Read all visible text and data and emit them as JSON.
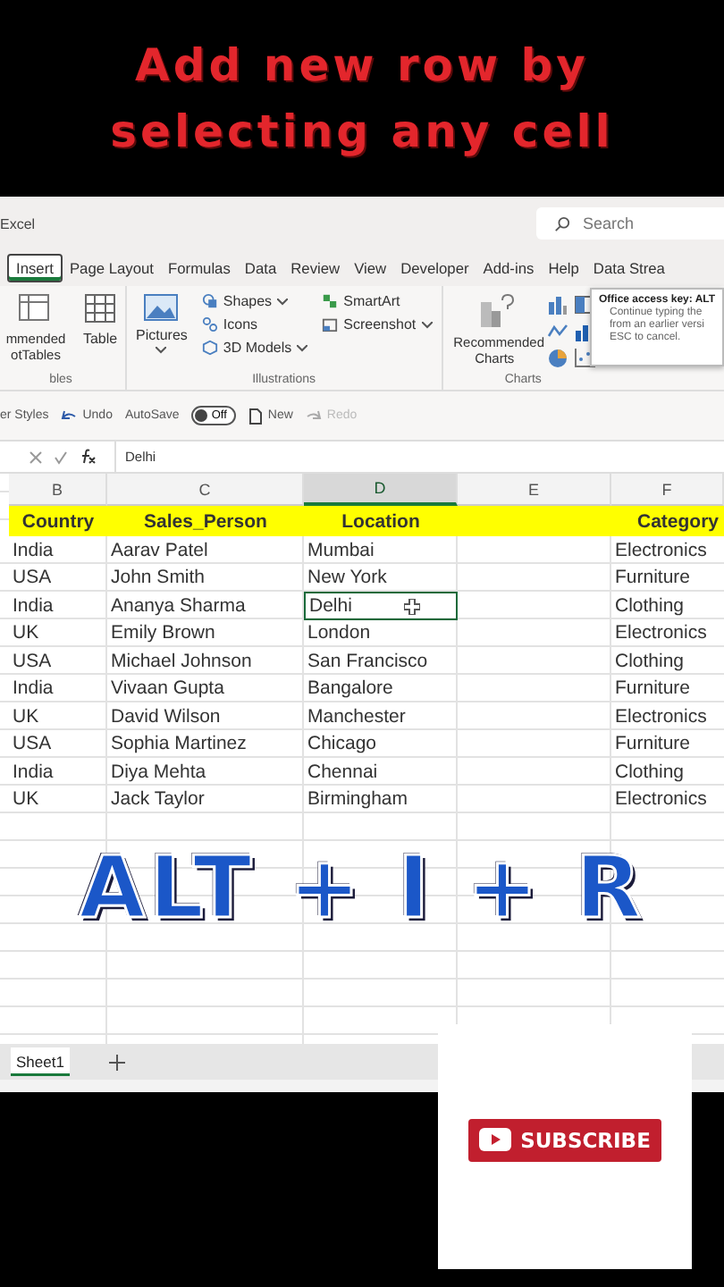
{
  "caption": {
    "lines": [
      "Add new row by",
      "selecting any cell"
    ]
  },
  "window": {
    "title": "Excel",
    "search": {
      "placeholder": "Search"
    }
  },
  "ribbon_tabs": [
    {
      "label": "Insert",
      "selected": true
    },
    {
      "label": "Page Layout",
      "selected": false
    },
    {
      "label": "Formulas",
      "selected": false
    },
    {
      "label": "Data",
      "selected": false
    },
    {
      "label": "Review",
      "selected": false
    },
    {
      "label": "View",
      "selected": false
    },
    {
      "label": "Developer",
      "selected": false
    },
    {
      "label": "Add-ins",
      "selected": false
    },
    {
      "label": "Help",
      "selected": false
    },
    {
      "label": "Data Strea",
      "selected": false
    }
  ],
  "ribbon": {
    "tables": {
      "label": "bles",
      "commands": [
        {
          "label": "mmended otTables"
        },
        {
          "label": "Table"
        }
      ]
    },
    "illustrations": {
      "label": "Illustrations",
      "pictures": {
        "label": "Pictures",
        "dropdown": true
      },
      "small": [
        {
          "label": "Shapes",
          "dropdown": true
        },
        {
          "label": "Icons",
          "dropdown": false
        },
        {
          "label": "3D Models",
          "dropdown": true
        },
        {
          "label": "SmartArt",
          "dropdown": false
        },
        {
          "label": "Screenshot",
          "dropdown": true
        }
      ]
    },
    "charts": {
      "label": "Charts",
      "recommended": {
        "label": "Recommended Charts"
      }
    }
  },
  "tooltip": {
    "title": "Office access key: ALT",
    "lines": [
      "Continue typing the",
      "from an earlier versi",
      "ESC to cancel."
    ]
  },
  "quick_access": {
    "styles": "er Styles",
    "undo": "Undo",
    "autosave": {
      "label": "AutoSave",
      "on": false,
      "state": "Off"
    },
    "new": "New",
    "redo": "Redo"
  },
  "formula_bar": {
    "value": "Delhi"
  },
  "columns": [
    {
      "letter": "B",
      "kind": "data",
      "selected": false
    },
    {
      "letter": "C",
      "kind": "data",
      "selected": false
    },
    {
      "letter": "D",
      "kind": "data",
      "selected": true
    },
    {
      "letter": "E",
      "kind": "blank",
      "selected": false
    },
    {
      "letter": "F",
      "kind": "data",
      "selected": false
    }
  ],
  "header": [
    "Country",
    "Sales_Person",
    "Location",
    "Category"
  ],
  "rows": [
    {
      "cells": [
        "India",
        "Aarav Patel",
        "Mumbai",
        "Electronics"
      ],
      "selected": false
    },
    {
      "cells": [
        "USA",
        "John Smith",
        "New York",
        "Furniture"
      ],
      "selected": false
    },
    {
      "cells": [
        "India",
        "Ananya Sharma",
        "Delhi",
        "Clothing"
      ],
      "selected": true
    },
    {
      "cells": [
        "UK",
        "Emily Brown",
        "London",
        "Electronics"
      ],
      "selected": false
    },
    {
      "cells": [
        "USA",
        "Michael Johnson",
        "San Francisco",
        "Clothing"
      ],
      "selected": false
    },
    {
      "cells": [
        "India",
        "Vivaan Gupta",
        "Bangalore",
        "Furniture"
      ],
      "selected": false
    },
    {
      "cells": [
        "UK",
        "David Wilson",
        "Manchester",
        "Electronics"
      ],
      "selected": false
    },
    {
      "cells": [
        "USA",
        "Sophia Martinez",
        "Chicago",
        "Furniture"
      ],
      "selected": false
    },
    {
      "cells": [
        "India",
        "Diya Mehta",
        "Chennai",
        "Clothing"
      ],
      "selected": false
    },
    {
      "cells": [
        "UK",
        "Jack Taylor",
        "Birmingham",
        "Electronics"
      ],
      "selected": false
    }
  ],
  "shortcut": "ALT + I + R",
  "sheet_tabs": [
    {
      "label": "Sheet1",
      "selected": true
    }
  ],
  "subscribe": {
    "label": "SUBSCRIBE"
  }
}
